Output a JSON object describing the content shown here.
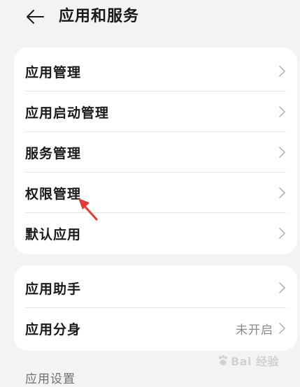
{
  "header": {
    "title": "应用和服务"
  },
  "group1": {
    "items": [
      {
        "label": "应用管理"
      },
      {
        "label": "应用启动管理"
      },
      {
        "label": "服务管理"
      },
      {
        "label": "权限管理"
      },
      {
        "label": "默认应用"
      }
    ]
  },
  "group2": {
    "items": [
      {
        "label": "应用助手",
        "value": ""
      },
      {
        "label": "应用分身",
        "value": "未开启"
      }
    ]
  },
  "section": {
    "title": "应用设置"
  },
  "watermark": {
    "text": "Bai 经验"
  },
  "colors": {
    "background": "#f1f3f5",
    "card": "#ffffff",
    "annotation_arrow": "#e53935"
  },
  "icons": {
    "back": "arrow-left-icon",
    "chevron": "chevron-right-icon"
  }
}
